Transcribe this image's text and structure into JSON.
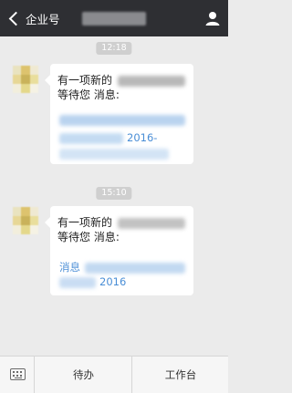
{
  "header": {
    "back_label": "企业号"
  },
  "messages": [
    {
      "time": "12:18",
      "line1": "有一项新的",
      "line2": "等待您 消息:",
      "link_tail": "2016-"
    },
    {
      "time": "15:10",
      "line1": "有一项新的",
      "line2": "等待您 消息:",
      "link_head": "消息",
      "link_tail": "2016"
    }
  ],
  "tabbar": {
    "tabs": [
      {
        "label": "待办"
      },
      {
        "label": "工作台"
      }
    ]
  },
  "colors": {
    "header_bg": "#2e2f33",
    "chat_bg": "#ebebeb",
    "bubble_bg": "#ffffff",
    "link": "#4a8ed6",
    "tabbar_bg": "#f6f6f6"
  },
  "icons": {
    "back": "chevron-left-icon",
    "user": "user-icon",
    "keyboard": "keyboard-icon"
  }
}
